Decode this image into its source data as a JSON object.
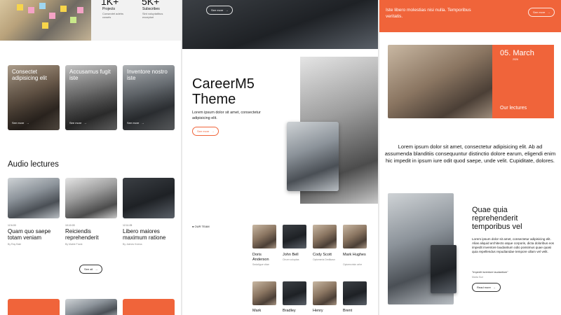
{
  "panel1": {
    "stats": [
      {
        "label": "Projects",
        "sub": "Consectet adehs cowels"
      },
      {
        "label": "Subscribes",
        "sub": "Sint voluptatibus excepturi"
      }
    ],
    "tiles": [
      {
        "title": "Consectet adipisicing elit",
        "more": "See more"
      },
      {
        "title": "Accusamus fugit iste",
        "more": "See more"
      },
      {
        "title": "Inventore nostro iste",
        "more": "See more"
      }
    ],
    "audio_heading": "Audio lectures",
    "lectures": [
      {
        "date": "12.6.00",
        "title": "Quam quo saepe totam veniam",
        "author": "By Ray Bale"
      },
      {
        "date": "10.10.03",
        "title": "Reiciendis reprehenderit",
        "author": "By Mable Frank"
      },
      {
        "date": "12.11.05",
        "title": "Libero maiores maximum ratione",
        "author": "By Jaimes Knews"
      }
    ],
    "see_all": "See all"
  },
  "panel2": {
    "top_button": "See more",
    "hero_title": "CareerM5 Theme",
    "hero_text": "Lorem ipsum dolor sit amet, consectetur adipisicing elit.",
    "hero_button": "See more",
    "team_tag": "● OUR TEAM",
    "team": [
      {
        "name": "Doris Anderson",
        "role": "Sedaligue vitae"
      },
      {
        "name": "John Bell",
        "role": "Ctrum voluptas"
      },
      {
        "name": "Cody Scott",
        "role": "Optomeria Dedikasn"
      },
      {
        "name": "Mark Hughes",
        "role": "Opicencrisin arhe"
      },
      {
        "name": "Mark",
        "role": ""
      },
      {
        "name": "Bradley",
        "role": ""
      },
      {
        "name": "Henry",
        "role": ""
      },
      {
        "name": "Brent",
        "role": ""
      }
    ]
  },
  "panel3": {
    "banner_text": "Iste libero molestias nisi nulla. Temporibus veritatis.",
    "banner_button": "See more",
    "date": "05. March",
    "year": "2026",
    "date_caption": "Our lectures",
    "quote": "Lorem ipsum dolor sit amet, consectetur adipisicing elit. Ab ad assumenda blanditiis consequuntur distinctio dolore earum, eligendi enim hic impedit in ipsum iure odit quod saepe, unde velit. Cupiditate, dolores.",
    "feature_title": "Quae quia reprehenderit temporibus vel",
    "feature_text": "Lorem ipsum dolor sit amet, consectetur adipisicing elit. Alias aliquid architecto atque corporis, dicta doloribus eos impedit inventore laudantium odio possimus quae quasi quia repellendus repudiandae tempore ullam vel velit.",
    "feature_quote": "\"Impedit inventore laudantium\"",
    "feature_author": "Marta Sue",
    "feature_button": "Read more"
  },
  "colors": {
    "accent": "#f0643a",
    "text": "#111111",
    "muted": "#888888"
  },
  "icons": [
    "arrow-right-icon"
  ]
}
